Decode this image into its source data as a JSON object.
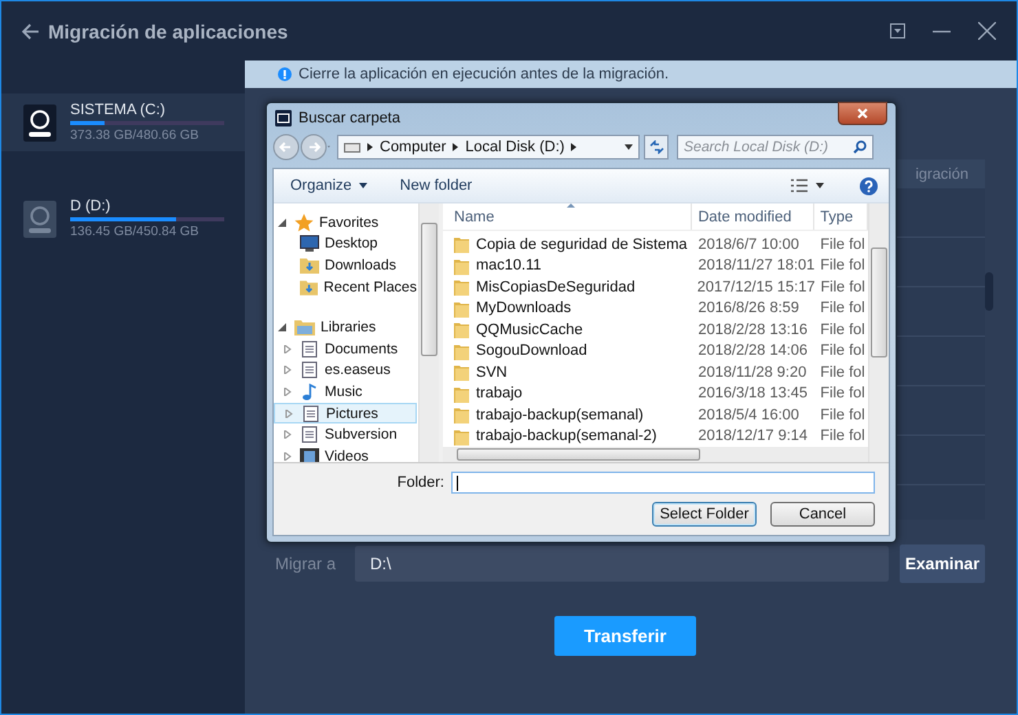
{
  "window": {
    "title": "Migración de aplicaciones"
  },
  "drives": [
    {
      "name": "SISTEMA (C:)",
      "usage": "373.38 GB/480.66 GB",
      "level": 0.22,
      "selected": true
    },
    {
      "name": "D (D:)",
      "usage": "136.45 GB/450.84 GB",
      "level": 0.69,
      "selected": false
    }
  ],
  "notice": "Cierre la aplicación en ejecución antes de la migración.",
  "app_table": {
    "column_header": "igración"
  },
  "dialog": {
    "title": "Buscar carpeta",
    "breadcrumb": [
      "Computer",
      "Local Disk (D:)"
    ],
    "search": {
      "placeholder": "Search Local Disk (D:)"
    },
    "toolbar": [
      {
        "label": "Organize",
        "menu": true
      },
      {
        "label": "New folder",
        "menu": false
      }
    ],
    "nav": [
      {
        "label": "Favorites",
        "expanded": true,
        "children": [
          {
            "label": "Desktop",
            "selected": false
          },
          {
            "label": "Downloads",
            "selected": false
          },
          {
            "label": "Recent Places",
            "selected": false
          }
        ]
      },
      {
        "label": "Libraries",
        "expanded": true,
        "children": [
          {
            "label": "Documents",
            "selected": false
          },
          {
            "label": "es.easeus",
            "selected": false
          },
          {
            "label": "Music",
            "selected": false
          },
          {
            "label": "Pictures",
            "selected": true
          },
          {
            "label": "Subversion",
            "selected": false
          },
          {
            "label": "Videos",
            "selected": false
          }
        ]
      }
    ],
    "columns": [
      {
        "label": "Name",
        "sorted": true
      },
      {
        "label": "Date modified",
        "sorted": false
      },
      {
        "label": "Type",
        "sorted": false
      }
    ],
    "files": [
      {
        "name": "Copia de seguridad de Sistema",
        "date": "2018/6/7 10:00",
        "type": "File fol"
      },
      {
        "name": "mac10.11",
        "date": "2018/11/27 18:01",
        "type": "File fol"
      },
      {
        "name": "MisCopiasDeSeguridad",
        "date": "2017/12/15 15:17",
        "type": "File fol"
      },
      {
        "name": "MyDownloads",
        "date": "2016/8/26 8:59",
        "type": "File fol"
      },
      {
        "name": "QQMusicCache",
        "date": "2018/2/28 13:16",
        "type": "File fol"
      },
      {
        "name": "SogouDownload",
        "date": "2018/2/28 14:06",
        "type": "File fol"
      },
      {
        "name": "SVN",
        "date": "2018/11/28 9:20",
        "type": "File fol"
      },
      {
        "name": "trabajo",
        "date": "2016/3/18 13:45",
        "type": "File fol"
      },
      {
        "name": "trabajo-backup(semanal)",
        "date": "2018/5/4 16:00",
        "type": "File fol"
      },
      {
        "name": "trabajo-backup(semanal-2)",
        "date": "2018/12/17 9:14",
        "type": "File fol"
      }
    ],
    "folder_label": "Folder:",
    "buttons": [
      {
        "label": "Select Folder",
        "default": true
      },
      {
        "label": "Cancel",
        "default": false
      }
    ]
  },
  "destination": {
    "label": "Migrar a",
    "value": "D:\\",
    "browse": "Examinar"
  },
  "transfer_button": "Transferir"
}
